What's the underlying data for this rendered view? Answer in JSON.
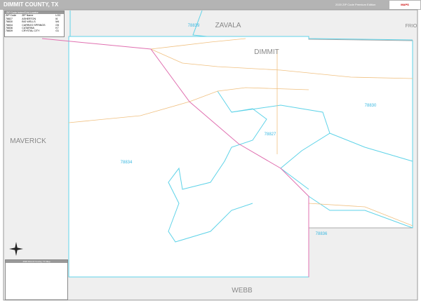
{
  "header": {
    "title": "DIMMIT COUNTY, TX",
    "edition": "2020 ZIP Code Premium Edition",
    "logo": "MAPS"
  },
  "zip_legend": {
    "title": "ZIP Code Index/Grid Locator",
    "columns": [
      "ZIP Code",
      "ZIP Name",
      "LOC"
    ],
    "rows": [
      [
        "78827",
        "ASHERTON",
        "I6"
      ],
      [
        "78830",
        "BIG WELLS",
        "M4"
      ],
      [
        "78834",
        "CARRIZO SPRINGS",
        "G5"
      ],
      [
        "78836",
        "CATARINA",
        "K7"
      ],
      [
        "78839",
        "CRYSTAL CITY",
        "G1"
      ]
    ]
  },
  "map_legend": {
    "title": "2020 Dimmit County, TX Map"
  },
  "labels": {
    "counties": [
      "ZAVALA",
      "DIMMIT",
      "MAVERICK",
      "WEBB",
      "FRIO"
    ],
    "zips": [
      "78839",
      "78830",
      "78827",
      "78834",
      "78836"
    ]
  },
  "colors": {
    "header": "#b4b4b4",
    "zip_boundary": "#5fd3e8",
    "highway": "#e070b0",
    "roads": "#f0c080",
    "outside": "#efefef"
  }
}
